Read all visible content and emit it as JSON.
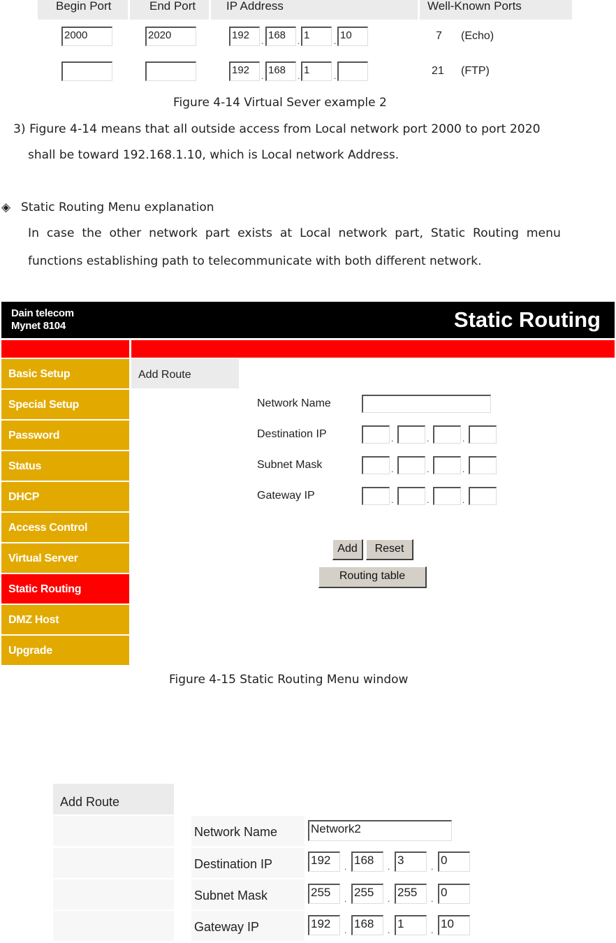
{
  "figure_4_14": {
    "headers": [
      "Begin Port",
      "End Port",
      "IP Address",
      "Well-Known Ports"
    ],
    "rows": [
      {
        "begin_port": "2000",
        "end_port": "2020",
        "ip": [
          "192",
          "168",
          "1",
          "10"
        ],
        "wk_port": "7",
        "wk_name": "(Echo)"
      },
      {
        "begin_port": "",
        "end_port": "",
        "ip": [
          "192",
          "168",
          "1",
          ""
        ],
        "wk_port": "21",
        "wk_name": "(FTP)"
      }
    ],
    "caption": "Figure 4-14 Virtual Sever example 2"
  },
  "paragraph_3": {
    "line1": "3) Figure 4-14 means that all outside access from Local network port 2000 to port 2020",
    "line2": "shall be toward 192.168.1.10, which is Local network Address."
  },
  "section": {
    "bullet": "◈",
    "heading": "Static Routing Menu explanation",
    "body_line1": "In  case  the  other  network  part  exists  at  Local  network  part,  Static  Routing  menu",
    "body_line2": "functions establishing path to telecommunicate with both different network."
  },
  "router_ui": {
    "brand_line1": "Dain telecom",
    "brand_line2": "Mynet 8104",
    "page_title": "Static Routing",
    "sidebar": [
      {
        "label": "Basic  Setup",
        "active": false
      },
      {
        "label": "Special Setup",
        "active": false
      },
      {
        "label": "Password",
        "active": false
      },
      {
        "label": "Status",
        "active": false
      },
      {
        "label": "DHCP",
        "active": false
      },
      {
        "label": "Access Control",
        "active": false
      },
      {
        "label": "Virtual Server",
        "active": false
      },
      {
        "label": "Static Routing",
        "active": true
      },
      {
        "label": "DMZ Host",
        "active": false
      },
      {
        "label": "Upgrade",
        "active": false
      }
    ],
    "tab_label": "Add Route",
    "form": {
      "network_name_label": "Network Name",
      "network_name_value": "",
      "destination_ip_label": "Destination IP",
      "destination_ip": [
        "",
        "",
        "",
        ""
      ],
      "subnet_mask_label": "Subnet Mask",
      "subnet_mask": [
        "",
        "",
        "",
        ""
      ],
      "gateway_ip_label": "Gateway IP",
      "gateway_ip": [
        "",
        "",
        "",
        ""
      ]
    },
    "buttons": {
      "add": "Add",
      "reset": "Reset",
      "routing_table": "Routing table"
    },
    "caption": "Figure 4-15 Static Routing Menu window"
  },
  "example": {
    "tab_label": "Add Route",
    "network_name_label": "Network Name",
    "network_name_value": "Network2",
    "destination_ip_label": "Destination IP",
    "destination_ip": [
      "192",
      "168",
      "3",
      "0"
    ],
    "subnet_mask_label": "Subnet Mask",
    "subnet_mask": [
      "255",
      "255",
      "255",
      "0"
    ],
    "gateway_ip_label": "Gateway IP",
    "gateway_ip": [
      "192",
      "168",
      "1",
      "10"
    ]
  },
  "colors": {
    "sidebar_bg": "#e2aa00",
    "active_red": "#ff0000",
    "topbar_bg": "#000000",
    "tab_bg": "#ebebeb"
  }
}
